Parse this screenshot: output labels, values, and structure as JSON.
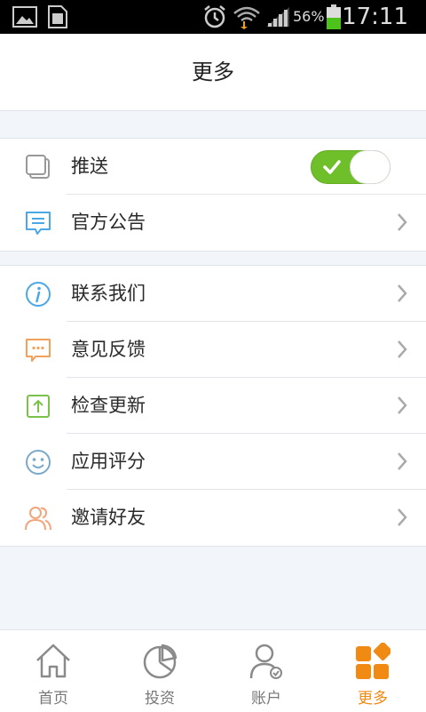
{
  "status_bar": {
    "battery_percent": "56%",
    "time": "17:11",
    "icons": [
      "image-icon",
      "sim-card-icon",
      "alarm-icon",
      "wifi-icon",
      "signal-icon",
      "battery-icon"
    ]
  },
  "header": {
    "title": "更多"
  },
  "group1": {
    "items": [
      {
        "label": "推送",
        "icon": "push-icon",
        "toggle_on": true
      },
      {
        "label": "官方公告",
        "icon": "announcement-icon"
      }
    ]
  },
  "group2": {
    "items": [
      {
        "label": "联系我们",
        "icon": "info-icon"
      },
      {
        "label": "意见反馈",
        "icon": "feedback-icon"
      },
      {
        "label": "检查更新",
        "icon": "update-icon"
      },
      {
        "label": "应用评分",
        "icon": "smiley-icon"
      },
      {
        "label": "邀请好友",
        "icon": "invite-friends-icon"
      }
    ]
  },
  "tabbar": {
    "tabs": [
      {
        "label": "首页",
        "icon": "home-icon",
        "active": false
      },
      {
        "label": "投资",
        "icon": "pie-chart-icon",
        "active": false
      },
      {
        "label": "账户",
        "icon": "account-icon",
        "active": false
      },
      {
        "label": "更多",
        "icon": "more-grid-icon",
        "active": true
      }
    ]
  },
  "colors": {
    "toggle_on": "#6fbf2a",
    "active_tab": "#f08a12",
    "info_icon": "#4aa8e6",
    "feedback_icon": "#f2a15a",
    "update_icon": "#7cc24a",
    "smiley_icon": "#7aa9c9",
    "invite_icon": "#f2a57a"
  }
}
